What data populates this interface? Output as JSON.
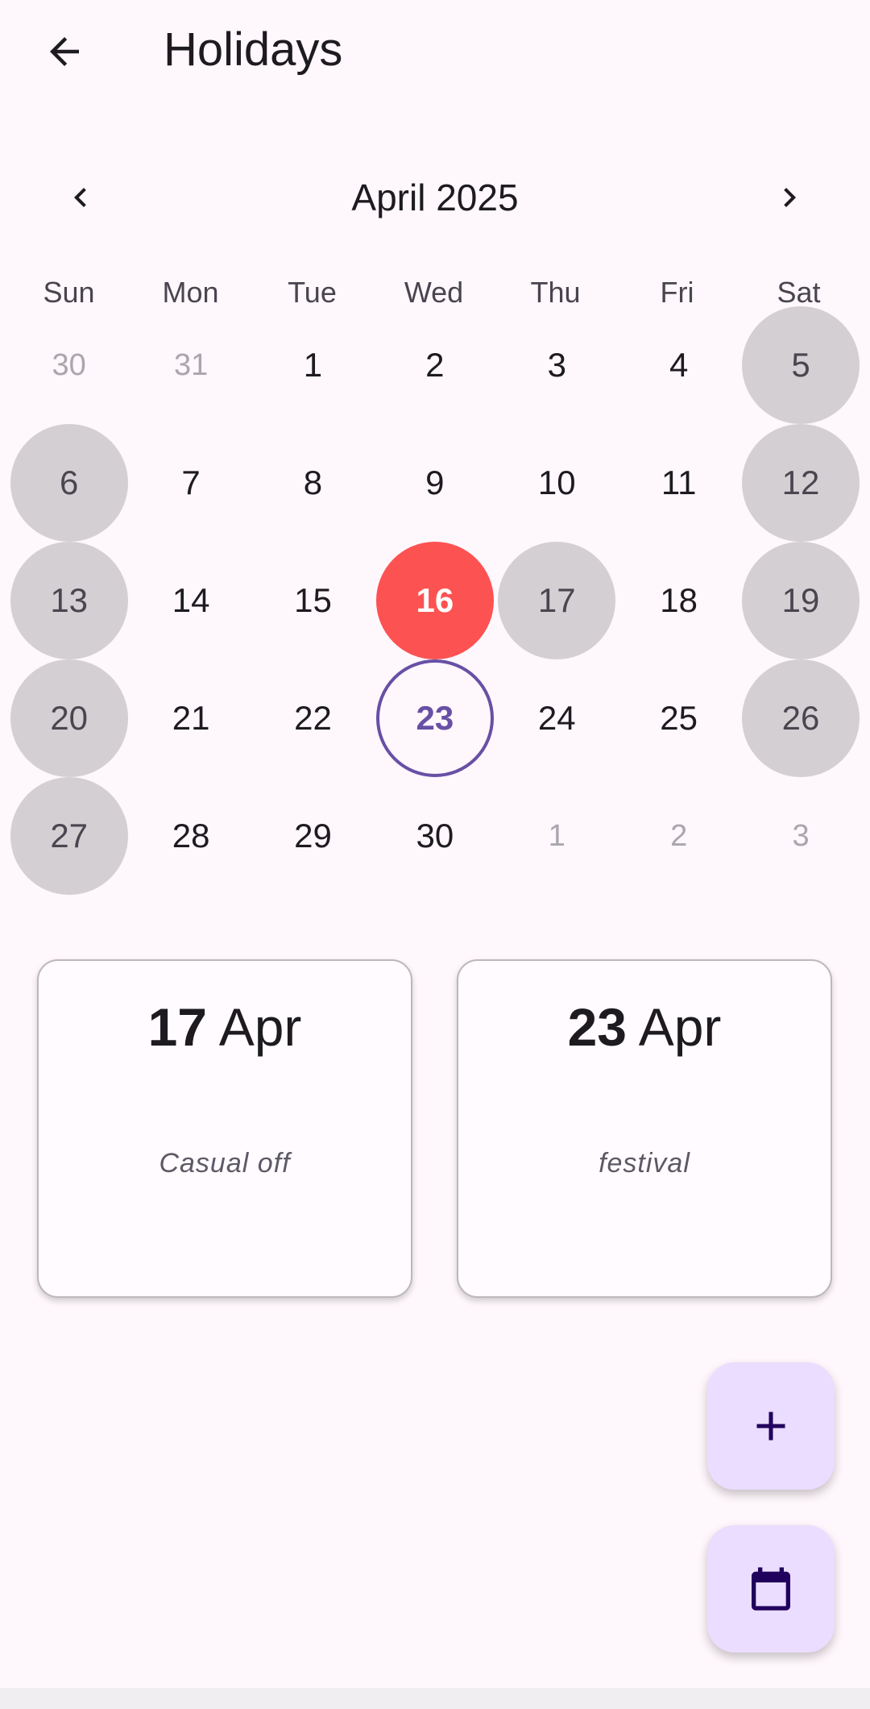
{
  "app_bar": {
    "title": "Holidays",
    "back_icon": "arrow-back-icon"
  },
  "calendar": {
    "month_label": "April 2025",
    "prev_icon": "chevron-left-icon",
    "next_icon": "chevron-right-icon",
    "weekdays": [
      "Sun",
      "Mon",
      "Tue",
      "Wed",
      "Thu",
      "Fri",
      "Sat"
    ],
    "days": [
      {
        "label": "30",
        "state": "outside"
      },
      {
        "label": "31",
        "state": "outside"
      },
      {
        "label": "1",
        "state": "normal"
      },
      {
        "label": "2",
        "state": "normal"
      },
      {
        "label": "3",
        "state": "normal"
      },
      {
        "label": "4",
        "state": "normal"
      },
      {
        "label": "5",
        "state": "holiday"
      },
      {
        "label": "6",
        "state": "holiday"
      },
      {
        "label": "7",
        "state": "normal"
      },
      {
        "label": "8",
        "state": "normal"
      },
      {
        "label": "9",
        "state": "normal"
      },
      {
        "label": "10",
        "state": "normal"
      },
      {
        "label": "11",
        "state": "normal"
      },
      {
        "label": "12",
        "state": "holiday"
      },
      {
        "label": "13",
        "state": "holiday"
      },
      {
        "label": "14",
        "state": "normal"
      },
      {
        "label": "15",
        "state": "normal"
      },
      {
        "label": "16",
        "state": "selected"
      },
      {
        "label": "17",
        "state": "holiday"
      },
      {
        "label": "18",
        "state": "normal"
      },
      {
        "label": "19",
        "state": "holiday"
      },
      {
        "label": "20",
        "state": "holiday"
      },
      {
        "label": "21",
        "state": "normal"
      },
      {
        "label": "22",
        "state": "normal"
      },
      {
        "label": "23",
        "state": "today"
      },
      {
        "label": "24",
        "state": "normal"
      },
      {
        "label": "25",
        "state": "normal"
      },
      {
        "label": "26",
        "state": "holiday"
      },
      {
        "label": "27",
        "state": "holiday"
      },
      {
        "label": "28",
        "state": "normal"
      },
      {
        "label": "29",
        "state": "normal"
      },
      {
        "label": "30",
        "state": "normal"
      },
      {
        "label": "1",
        "state": "outside"
      },
      {
        "label": "2",
        "state": "outside"
      },
      {
        "label": "3",
        "state": "outside"
      }
    ]
  },
  "holiday_cards": [
    {
      "day": "17",
      "month": "Apr",
      "note": "Casual off"
    },
    {
      "day": "23",
      "month": "Apr",
      "note": "festival"
    }
  ],
  "fabs": {
    "add_icon": "plus-icon",
    "calendar_icon": "calendar-icon"
  },
  "colors": {
    "background": "#fef7fc",
    "selected_day": "#fd5252",
    "holiday_day": "#d3cfd3",
    "today_ring": "#6750a4",
    "fab": "#eaddff"
  }
}
